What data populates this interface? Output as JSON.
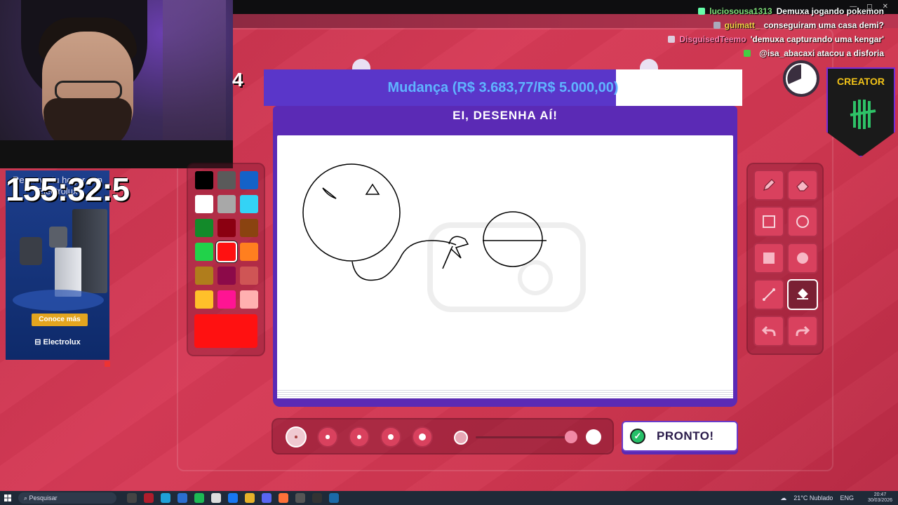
{
  "stream": {
    "small_counter": "4",
    "big_timer": "155:32:5"
  },
  "chat": {
    "messages": [
      {
        "user": "luciosousa1313",
        "text": "Demuxa jogando pokemon",
        "color": "#7fe07a",
        "badge": "#6fa"
      },
      {
        "user": "guimatt_",
        "text": "conseguiram uma casa demi?",
        "color": "#f2d347",
        "badge": "#aab"
      },
      {
        "user": "DisguisedTeemo",
        "text": "'demuxa capturando uma kengar'",
        "color": "#ff7fb0",
        "badge": "#dcd"
      },
      {
        "user": "",
        "text": "@isa_abacaxi atacou a disforia",
        "color": "#e0304a",
        "badge": "#4c4"
      }
    ]
  },
  "goal": {
    "text": "Mudança (R$ 3.683,77/R$ 5.000,00)",
    "progress": 0.7367,
    "fill_color": "#5a36c9"
  },
  "creator_badge": {
    "label": "CREATOR"
  },
  "ad": {
    "headline": "Renueva tu hogar con Electrolux",
    "cta": "Conoce más",
    "brand": "Electrolux"
  },
  "game": {
    "header": "EI, DESENHA AÍ!",
    "done_label": "PRONTO!",
    "palette": [
      "#000000",
      "#5a5a5a",
      "#1462c8",
      "#ffffff",
      "#a8a8a8",
      "#33d3f5",
      "#138a2a",
      "#8b0011",
      "#8a4310",
      "#21d24a",
      "#ff1111",
      "#ff7f1f",
      "#b07d1c",
      "#8c0a49",
      "#cf5555",
      "#ffc02a",
      "#ff1493",
      "#ffb0b0"
    ],
    "selected_color_index": 10,
    "current_color": "#ff1111",
    "tools": [
      {
        "name": "pencil-tool",
        "icon": "pencil-icon"
      },
      {
        "name": "eraser-tool",
        "icon": "eraser-icon"
      },
      {
        "name": "rectangle-outline-tool",
        "icon": "square-outline-icon"
      },
      {
        "name": "circle-outline-tool",
        "icon": "circle-outline-icon"
      },
      {
        "name": "rectangle-fill-tool",
        "icon": "square-fill-icon"
      },
      {
        "name": "circle-fill-tool",
        "icon": "circle-fill-icon"
      },
      {
        "name": "line-tool",
        "icon": "line-icon"
      },
      {
        "name": "bucket-tool",
        "icon": "bucket-icon"
      },
      {
        "name": "undo-tool",
        "icon": "undo-icon"
      },
      {
        "name": "redo-tool",
        "icon": "redo-icon"
      }
    ],
    "active_tool_index": 7,
    "brush_sizes": [
      1,
      2,
      3,
      4,
      5
    ],
    "active_brush_size_index": 0
  },
  "taskbar": {
    "search_placeholder": "Pesquisar",
    "weather": "21°C Nublado",
    "lang": "ENG",
    "time": "20:47",
    "date": "30/03/2026"
  }
}
